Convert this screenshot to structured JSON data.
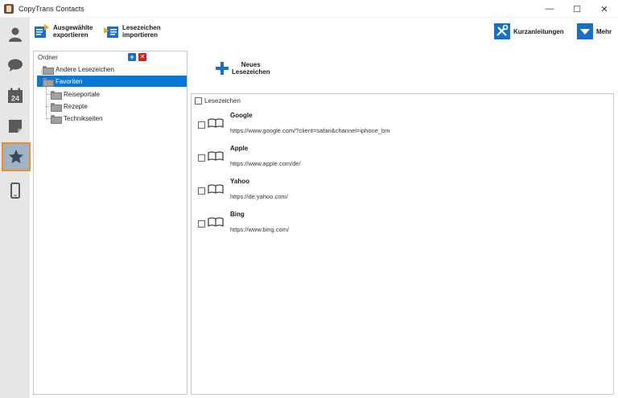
{
  "window": {
    "title": "CopyTrans Contacts",
    "minimize": "—",
    "maximize": "☐",
    "close": "✕"
  },
  "rail": {
    "items": [
      "contacts-icon",
      "messages-icon",
      "calendar-icon",
      "notes-icon",
      "bookmarks-icon",
      "phone-icon"
    ],
    "calendar_day": "24",
    "active_index": 4
  },
  "toolbar": {
    "export_line1": "Ausgewählte",
    "export_line2": "exportieren",
    "import_line1": "Lesezeichen",
    "import_line2": "importieren",
    "guides": "Kurzanleitungen",
    "more": "Mehr"
  },
  "folders": {
    "header": "Ordner",
    "add": "+",
    "remove": "✕",
    "items": [
      {
        "label": "Andere Lesezeichen",
        "level": 0,
        "selected": false
      },
      {
        "label": "Favoriten",
        "level": 0,
        "selected": true
      },
      {
        "label": "Reiseportale",
        "level": 1,
        "selected": false
      },
      {
        "label": "Rezepte",
        "level": 1,
        "selected": false
      },
      {
        "label": "Technikseiten",
        "level": 1,
        "selected": false
      }
    ]
  },
  "new_bookmark": {
    "line1": "Neues",
    "line2": "Lesezeichen"
  },
  "bookmarks": {
    "header": "Lesezeichen",
    "items": [
      {
        "name": "Google",
        "url": "https://www.google.com/?client=safari&channel=iphone_bm"
      },
      {
        "name": "Apple",
        "url": "https://www.apple.com/de/"
      },
      {
        "name": "Yahoo",
        "url": "https://de.yahoo.com/"
      },
      {
        "name": "Bing",
        "url": "https://www.bing.com/"
      }
    ]
  },
  "colors": {
    "accent": "#0a78d7",
    "active_border": "#f28c28",
    "rail_bg": "#e6e6e6"
  }
}
